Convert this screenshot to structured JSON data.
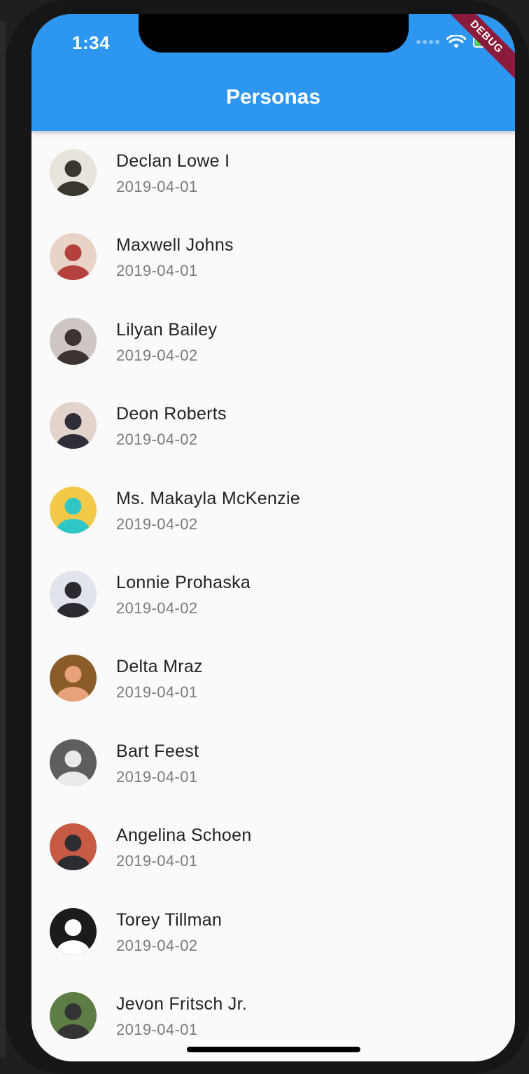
{
  "status_bar": {
    "time": "1:34"
  },
  "app_bar": {
    "title": "Personas"
  },
  "debug_banner": "DEBUG",
  "people": [
    {
      "name": "Declan Lowe I",
      "date": "2019-04-01",
      "avatar_colors": [
        "#e8e4dc",
        "#3b3630"
      ]
    },
    {
      "name": "Maxwell Johns",
      "date": "2019-04-01",
      "avatar_colors": [
        "#e9d3c6",
        "#b4413c"
      ]
    },
    {
      "name": "Lilyan Bailey",
      "date": "2019-04-02",
      "avatar_colors": [
        "#cfc7c4",
        "#3c3431"
      ]
    },
    {
      "name": "Deon Roberts",
      "date": "2019-04-02",
      "avatar_colors": [
        "#e3d3cd",
        "#2e2d38"
      ]
    },
    {
      "name": "Ms. Makayla McKenzie",
      "date": "2019-04-02",
      "avatar_colors": [
        "#f3c94a",
        "#2ec7c6"
      ]
    },
    {
      "name": "Lonnie Prohaska",
      "date": "2019-04-02",
      "avatar_colors": [
        "#e1e4ec",
        "#2a2a30"
      ]
    },
    {
      "name": "Delta Mraz",
      "date": "2019-04-01",
      "avatar_colors": [
        "#8c5b2a",
        "#e8a279"
      ]
    },
    {
      "name": "Bart Feest",
      "date": "2019-04-01",
      "avatar_colors": [
        "#5e5e5e",
        "#eaeaea"
      ]
    },
    {
      "name": "Angelina Schoen",
      "date": "2019-04-01",
      "avatar_colors": [
        "#c85a43",
        "#2b2d33"
      ]
    },
    {
      "name": "Torey Tillman",
      "date": "2019-04-02",
      "avatar_colors": [
        "#1b1b1b",
        "#ffffff"
      ]
    },
    {
      "name": "Jevon Fritsch Jr.",
      "date": "2019-04-01",
      "avatar_colors": [
        "#5e7d45",
        "#333333"
      ]
    }
  ]
}
